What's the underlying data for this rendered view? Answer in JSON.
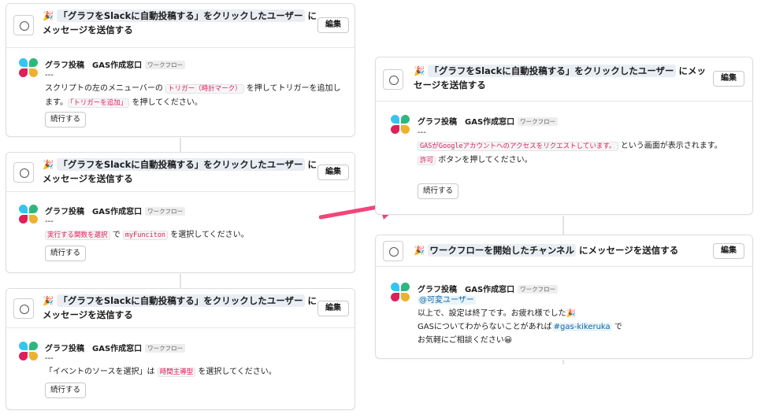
{
  "left_steps": [
    {
      "icon": "message-icon",
      "title_prefix": "🎉 ",
      "title_highlight": "「グラフをSlackに自動投稿する」をクリックしたユーザー",
      "title_suffix": " にメッセージを送信する",
      "edit_label": "編集",
      "sender": "グラフ投稿　GAS作成窓口",
      "tag": "ワークフロー",
      "dashes": "---",
      "line1_parts": [
        "スクリプトの左のメニューバーの ",
        "トリガー（時計マーク）",
        " を押してトリガーを追加します。",
        "「トリガーを追加」",
        " を押してください。"
      ],
      "button": "続行する"
    },
    {
      "icon": "message-icon",
      "title_prefix": "🎉 ",
      "title_highlight": "「グラフをSlackに自動投稿する」をクリックしたユーザー",
      "title_suffix": " にメッセージを送信する",
      "edit_label": "編集",
      "sender": "グラフ投稿　GAS作成窓口",
      "tag": "ワークフロー",
      "dashes": "---",
      "line1_parts": [
        "実行する関数を選択",
        " で ",
        "myFunciton",
        " を選択してください。"
      ],
      "button": "続行する"
    },
    {
      "icon": "message-icon",
      "title_prefix": "🎉 ",
      "title_highlight": "「グラフをSlackに自動投稿する」をクリックしたユーザー",
      "title_suffix": " にメッセージを送信する",
      "edit_label": "編集",
      "sender": "グラフ投稿　GAS作成窓口",
      "tag": "ワークフロー",
      "dashes": "---",
      "line1_parts": [
        "「イベントのソースを選択」は ",
        "時間主導型",
        " を選択してください。"
      ],
      "button": "続行する"
    }
  ],
  "right_steps": [
    {
      "icon": "message-icon",
      "title_prefix": "🎉 ",
      "title_highlight": "「グラフをSlackに自動投稿する」をクリックしたユーザー",
      "title_suffix": " にメッセージを送信する",
      "edit_label": "編集",
      "sender": "グラフ投稿　GAS作成窓口",
      "tag": "ワークフロー",
      "dashes": "---",
      "line1_parts": [
        "GASがGoogleアカウントへのアクセスをリクエストしています。",
        " という画面が表示されます。"
      ],
      "line2_parts": [
        "許可",
        " ボタンを押してください。"
      ],
      "button": "続行する"
    },
    {
      "icon": "message-icon",
      "title_prefix": "🎉 ",
      "title_highlight": "ワークフローを開始したチャンネル",
      "title_suffix": " にメッセージを送信する",
      "edit_label": "編集",
      "sender": "グラフ投稿　GAS作成窓口",
      "tag": "ワークフロー",
      "mention": "@可変ユーザー",
      "line1": "以上で、設定は終了です。お疲れ様でした🎉",
      "line2_parts": [
        "GASについてわからないことがあれば",
        "#gas-kikeruka",
        " で"
      ],
      "line3": "お気軽にご相談ください😀"
    }
  ],
  "arrow_color": "#f0467a"
}
